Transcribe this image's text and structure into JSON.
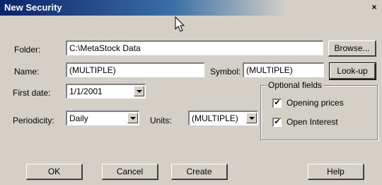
{
  "window": {
    "title": "New Security",
    "close_glyph": "×"
  },
  "folder": {
    "label": "Folder:",
    "value": "C:\\MetaStock Data",
    "browse_label": "Browse..."
  },
  "name": {
    "label": "Name:",
    "value": "(MULTIPLE)"
  },
  "symbol": {
    "label": "Symbol:",
    "value": "(MULTIPLE)",
    "lookup_label": "Look-up"
  },
  "first_date": {
    "label": "First date:",
    "value": "1/1/2001"
  },
  "periodicity": {
    "label": "Periodicity:",
    "value": "Daily"
  },
  "units": {
    "label": "Units:",
    "value": "(MULTIPLE)"
  },
  "optional_fields": {
    "legend": "Optional fields",
    "opening_prices": {
      "label": "Opening prices",
      "checked": true,
      "mark": "✔"
    },
    "open_interest": {
      "label": "Open Interest",
      "checked": true,
      "mark": "✔"
    }
  },
  "buttons": {
    "ok": "OK",
    "cancel": "Cancel",
    "create": "Create",
    "help": "Help"
  },
  "colors": {
    "title_start": "#0a246a",
    "title_end": "#d4d0c8",
    "face": "#d4d0c8"
  }
}
